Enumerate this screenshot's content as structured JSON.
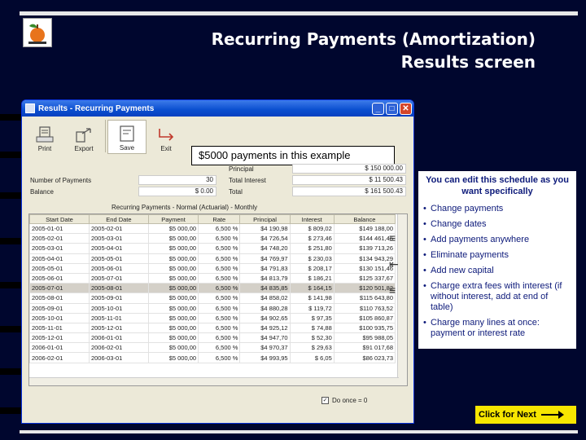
{
  "slide": {
    "title_line1": "Recurring Payments (Amortization)",
    "title_line2": "Results screen",
    "next_label": "Click for Next"
  },
  "window": {
    "title": "Results - Recurring Payments",
    "toolbar": [
      {
        "label": "Print",
        "icon": "print-icon"
      },
      {
        "label": "Export",
        "icon": "export-icon"
      },
      {
        "label": "Save",
        "icon": "save-icon"
      },
      {
        "label": "Exit",
        "icon": "exit-icon"
      }
    ],
    "callout": "$5000 payments in this example",
    "summary": {
      "number_of_payments_label": "Number of Payments",
      "number_of_payments": "30",
      "balance_label": "Balance",
      "balance": "$ 0.00",
      "principal_label": "Principal",
      "principal": "$ 150 000.00",
      "total_interest_label": "Total Interest",
      "total_interest": "$ 11 500.43",
      "total_label": "Total",
      "total": "$ 161 500.43"
    },
    "grid_title": "Recurring Payments - Normal (Actuarial) - Monthly",
    "columns": [
      "Start Date",
      "End Date",
      "Payment",
      "Rate",
      "Principal",
      "Interest",
      "Balance"
    ],
    "rows": [
      [
        "2005-01-01",
        "2005-02-01",
        "$5 000,00",
        "6,500 %",
        "$4 190,98",
        "$ 809,02",
        "$149 188,00"
      ],
      [
        "2005-02-01",
        "2005-03-01",
        "$5 000,00",
        "6,500 %",
        "$4 726,54",
        "$ 273,46",
        "$144 461,46"
      ],
      [
        "2005-03-01",
        "2005-04-01",
        "$5 000,00",
        "6,500 %",
        "$4 748,20",
        "$ 251,80",
        "$139 713,26"
      ],
      [
        "2005-04-01",
        "2005-05-01",
        "$5 000,00",
        "6,500 %",
        "$4 769,97",
        "$ 230,03",
        "$134 943,29"
      ],
      [
        "2005-05-01",
        "2005-06-01",
        "$5 000,00",
        "6,500 %",
        "$4 791,83",
        "$ 208,17",
        "$130 151,46"
      ],
      [
        "2005-06-01",
        "2005-07-01",
        "$5 000,00",
        "6,500 %",
        "$4 813,79",
        "$ 186,21",
        "$125 337,67"
      ],
      [
        "2005-07-01",
        "2005-08-01",
        "$5 000,00",
        "6,500 %",
        "$4 835,85",
        "$ 164,15",
        "$120 501,82"
      ],
      [
        "2005-08-01",
        "2005-09-01",
        "$5 000,00",
        "6,500 %",
        "$4 858,02",
        "$ 141,98",
        "$115 643,80"
      ],
      [
        "2005-09-01",
        "2005-10-01",
        "$5 000,00",
        "6,500 %",
        "$4 880,28",
        "$ 119,72",
        "$110 763,52"
      ],
      [
        "2005-10-01",
        "2005-11-01",
        "$5 000,00",
        "6,500 %",
        "$4 902,65",
        "$ 97,35",
        "$105 860,87"
      ],
      [
        "2005-11-01",
        "2005-12-01",
        "$5 000,00",
        "6,500 %",
        "$4 925,12",
        "$ 74,88",
        "$100 935,75"
      ],
      [
        "2005-12-01",
        "2006-01-01",
        "$5 000,00",
        "6,500 %",
        "$4 947,70",
        "$ 52,30",
        "$95 988,05"
      ],
      [
        "2006-01-01",
        "2006-02-01",
        "$5 000,00",
        "6,500 %",
        "$4 970,37",
        "$ 29,63",
        "$91 017,68"
      ],
      [
        "2006-02-01",
        "2006-03-01",
        "$5 000,00",
        "6,500 %",
        "$4 993,95",
        "$ 6,05",
        "$86 023,73"
      ]
    ],
    "selected_row": 6,
    "checkbox_label": "Do once = 0"
  },
  "notes": {
    "heading": "You can edit this schedule as you want specifically",
    "items": [
      "Change payments",
      "Change dates",
      "Add payments anywhere",
      "Eliminate payments",
      "Add new capital",
      "Charge extra fees with interest (if without interest, add at end of table)",
      "Charge many lines at once: payment or interest rate"
    ]
  },
  "colors": {
    "background": "#00062e",
    "notes_text": "#0d1a7a",
    "next_button": "#f7e600",
    "window_title": "#0a4ecf"
  }
}
